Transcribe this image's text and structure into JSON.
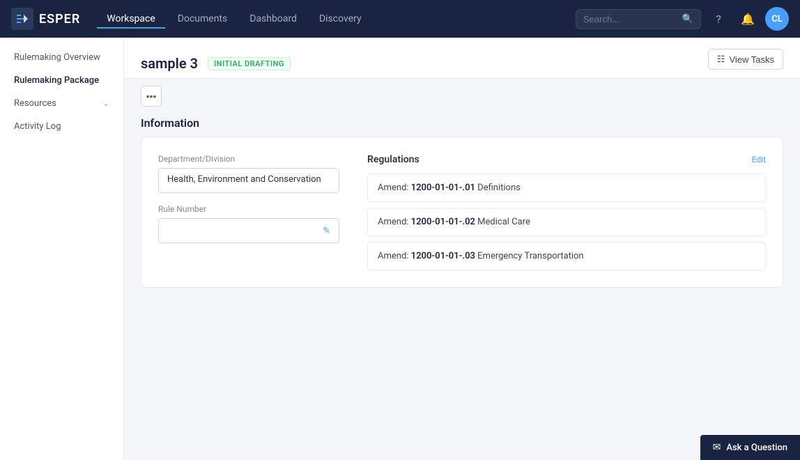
{
  "nav": {
    "logo_text": "ESPER",
    "links": [
      {
        "id": "workspace",
        "label": "Workspace",
        "active": true
      },
      {
        "id": "documents",
        "label": "Documents",
        "active": false
      },
      {
        "id": "dashboard",
        "label": "Dashboard",
        "active": false
      },
      {
        "id": "discovery",
        "label": "Discovery",
        "active": false
      }
    ],
    "search_placeholder": "Search...",
    "avatar_initials": "CL"
  },
  "sidebar": {
    "items": [
      {
        "id": "rulemaking-overview",
        "label": "Rulemaking Overview",
        "chevron": false
      },
      {
        "id": "rulemaking-package",
        "label": "Rulemaking Package",
        "chevron": false
      },
      {
        "id": "resources",
        "label": "Resources",
        "chevron": true
      },
      {
        "id": "activity-log",
        "label": "Activity Log",
        "chevron": false
      }
    ]
  },
  "page": {
    "title": "sample 3",
    "status": "INITIAL DRAFTING",
    "view_tasks_label": "View Tasks",
    "more_label": "•••",
    "section_title": "Information"
  },
  "form": {
    "department_label": "Department/Division",
    "department_value": "Health, Environment and Conservation",
    "rule_number_label": "Rule Number",
    "rule_number_placeholder": ""
  },
  "regulations": {
    "title": "Regulations",
    "edit_label": "Edit",
    "items": [
      {
        "prefix": "Amend: ",
        "code": "1200-01-01-.01",
        "suffix": " Definitions"
      },
      {
        "prefix": "Amend: ",
        "code": "1200-01-01-.02",
        "suffix": " Medical Care"
      },
      {
        "prefix": "Amend: ",
        "code": "1200-01-01-.03",
        "suffix": " Emergency Transportation"
      }
    ]
  },
  "ask_question": {
    "label": "Ask a Question"
  }
}
